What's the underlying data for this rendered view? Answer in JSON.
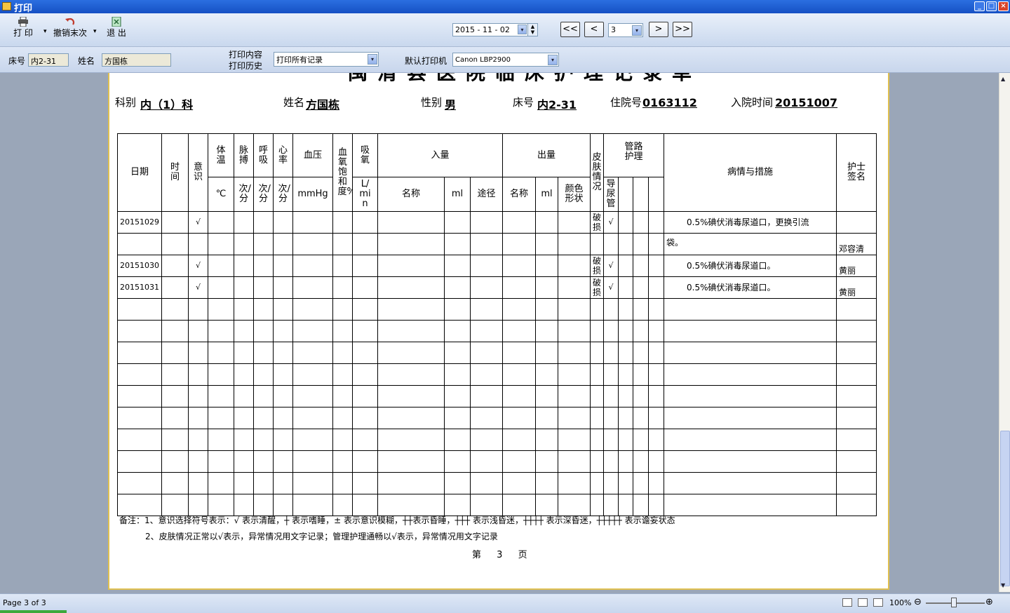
{
  "window": {
    "title": "打印"
  },
  "toolbar": {
    "print_label": "打 印",
    "undo_label": "撤销末次",
    "exit_label": "退 出",
    "date_value": "2015 - 11 - 02",
    "nav_first": "<<",
    "nav_prev": "<",
    "page_value": "3",
    "nav_next": ">",
    "nav_last": ">>"
  },
  "infobar": {
    "bed_label": "床号",
    "bed_value": "内2-31",
    "name_label": "姓名",
    "name_value": "方国栋",
    "print_content_label": "打印内容",
    "print_history_label": "打印历史",
    "print_content_value": "打印所有记录",
    "printer_label": "默认打印机",
    "printer_value": "Canon LBP2900"
  },
  "document": {
    "title": "闽清县医院临床护理记录单",
    "dept_label": "科别",
    "dept_value": "内（1）科",
    "name_label": "姓名",
    "name_value": "方国栋",
    "sex_label": "性别",
    "sex_value": "男",
    "bed_label": "床号",
    "bed_value": "内2-31",
    "inpatient_label": "住院号",
    "inpatient_value": "0163112",
    "admit_label": "入院时间",
    "admit_value": "20151007",
    "headers": {
      "date": "日期",
      "time": "时间",
      "conscious": "意识",
      "temp": "体温",
      "pulse": "脉搏",
      "resp": "呼吸",
      "heart": "心率",
      "bp": "血压",
      "spo2": "血氧饱和度%",
      "oxygen": "吸氧",
      "intake": "入量",
      "output": "出量",
      "skin": "皮肤情况",
      "tube": "管路护理",
      "condition": "病情与措施",
      "nurse": "护士签名",
      "temp_unit": "℃",
      "pulse_unit": "次/分",
      "resp_unit": "次/分",
      "heart_unit": "次/分",
      "bp_unit": "mmHg",
      "oxygen_unit": "L/min",
      "intake_name": "名称",
      "intake_ml": "ml",
      "intake_route": "途径",
      "output_name": "名称",
      "output_ml": "ml",
      "output_color": "颜色形状",
      "catheter": "导尿管"
    },
    "records": [
      {
        "date": "20151029",
        "conscious": "√",
        "skin": "破损",
        "catheter": "√",
        "condition": "0.5%碘伏消毒尿道口，更换引流",
        "condition_cont": "袋。",
        "nurse": "邓容清"
      },
      {
        "date": "20151030",
        "conscious": "√",
        "skin": "破损",
        "catheter": "√",
        "condition": "0.5%碘伏消毒尿道口。",
        "nurse": "黄丽"
      },
      {
        "date": "20151031",
        "conscious": "√",
        "skin": "破损",
        "catheter": "√",
        "condition": "0.5%碘伏消毒尿道口。",
        "nurse": "黄丽"
      }
    ],
    "note1": "备注：1、意识选择符号表示：√ 表示清醒，┼ 表示嗜睡，± 表示意识模糊，┼┼表示昏睡，┼┼┼ 表示浅昏迷，┼┼┼┼ 表示深昏迷，┼┼┼┼┼ 表示谵妄状态",
    "note2": "2、皮肤情况正常以√表示，异常情况用文字记录；管理护理通畅以√表示，异常情况用文字记录",
    "page_prefix": "第",
    "page_num": "3",
    "page_suffix": "页"
  },
  "statusbar": {
    "page_info": "Page 3 of 3",
    "zoom": "100%"
  }
}
